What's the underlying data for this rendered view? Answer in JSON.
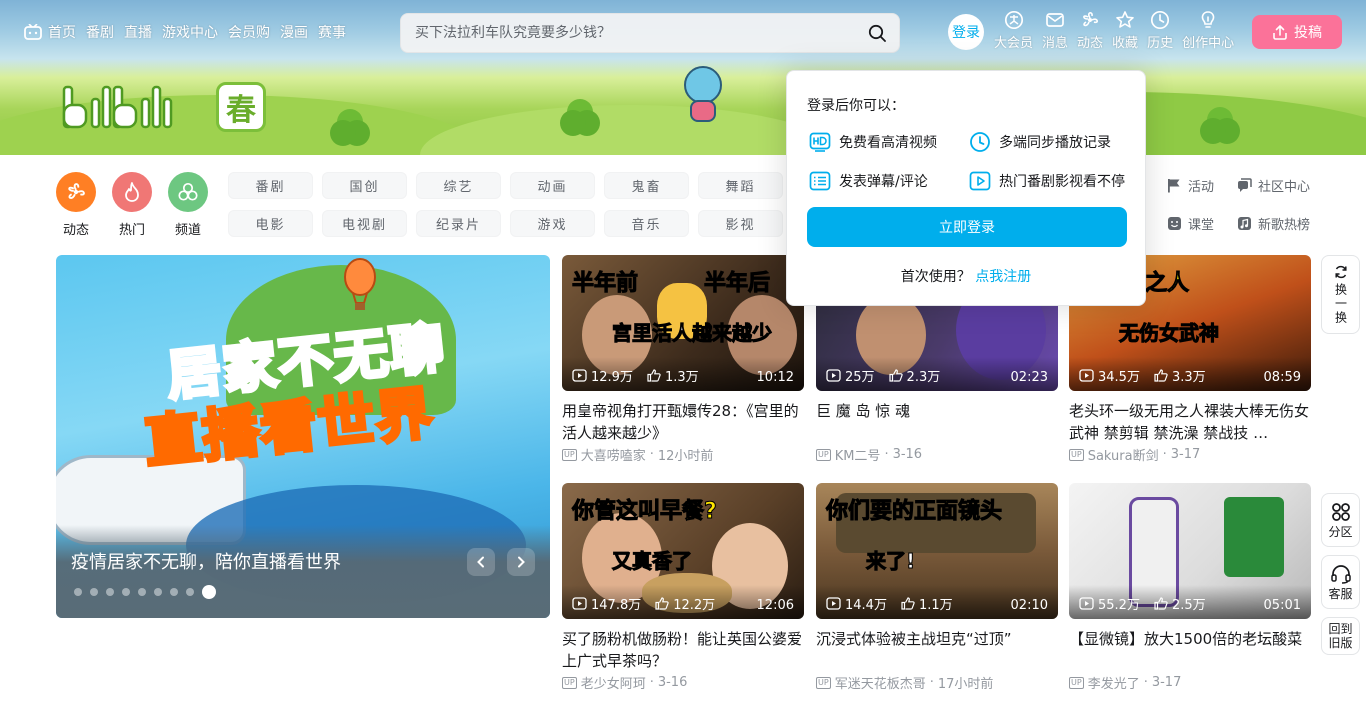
{
  "colors": {
    "brand_blue": "#00aeec",
    "brand_pink": "#fb7299",
    "dynamic_orange": "#ff7f24",
    "hot_red": "#f07775",
    "channel_green": "#6dc781"
  },
  "topnav": [
    {
      "label": "首页",
      "icon": "tv-icon"
    },
    {
      "label": "番剧"
    },
    {
      "label": "直播"
    },
    {
      "label": "游戏中心"
    },
    {
      "label": "会员购"
    },
    {
      "label": "漫画"
    },
    {
      "label": "赛事"
    }
  ],
  "search": {
    "placeholder": "买下法拉利车队究竟要多少钱？"
  },
  "header_right": {
    "login": "登录",
    "items": [
      {
        "label": "大会员",
        "icon": "vip-icon"
      },
      {
        "label": "消息",
        "icon": "mail-icon"
      },
      {
        "label": "动态",
        "icon": "wind-icon"
      },
      {
        "label": "收藏",
        "icon": "star-icon"
      },
      {
        "label": "历史",
        "icon": "clock-icon"
      },
      {
        "label": "创作中心",
        "icon": "bulb-icon"
      }
    ],
    "upload": "投稿"
  },
  "logo": {
    "seal": "春"
  },
  "channels": [
    {
      "label": "动态",
      "icon": "wind-icon",
      "color": "#ff7f24"
    },
    {
      "label": "热门",
      "icon": "flame-icon",
      "color": "#f07775"
    },
    {
      "label": "频道",
      "icon": "channel-icon",
      "color": "#6dc781"
    }
  ],
  "tags": [
    "番剧",
    "国创",
    "综艺",
    "动画",
    "鬼畜",
    "舞蹈",
    "电影",
    "电视剧",
    "纪录片",
    "游戏",
    "音乐",
    "影视"
  ],
  "side_links": [
    {
      "label": "活动",
      "icon": "flag-icon"
    },
    {
      "label": "社区中心",
      "icon": "community-icon"
    },
    {
      "label": "课堂",
      "icon": "class-icon"
    },
    {
      "label": "新歌热榜",
      "icon": "music-icon"
    }
  ],
  "banner": {
    "art_line1": "居家不无聊",
    "art_line2": "直播看世界",
    "caption": "疫情居家不无聊，陪你直播看世界",
    "dot_count": 9,
    "active_dot": 9
  },
  "videos": [
    {
      "views": "12.9万",
      "likes": "1.3万",
      "duration": "10:12",
      "title": "用皇帝视角打开甄嬛传28：《宫里的活人越来越少》",
      "author": "大喜唠嗑家",
      "time": "12小时前",
      "art1": "半年前　　　半年后",
      "art2": "宫里活人越来越少"
    },
    {
      "views": "25万",
      "likes": "2.3万",
      "duration": "02:23",
      "title": "巨 魔 岛 惊 魂",
      "author": "KM二号",
      "time": "3-16",
      "art1": "",
      "art2": ""
    },
    {
      "views": "34.5万",
      "likes": "3.3万",
      "duration": "08:59",
      "title": "老头环一级无用之人裸装大棒无伤女武神 禁剪辑 禁洗澡 禁战技 …",
      "author": "Sakura断剑",
      "time": "3-17",
      "art1": "级无用之人",
      "art2": "无伤女武神"
    },
    {
      "views": "147.8万",
      "likes": "12.2万",
      "duration": "12:06",
      "title": "买了肠粉机做肠粉！能让英国公婆爱上广式早茶吗？",
      "author": "老少女阿珂",
      "time": "3-16",
      "art1": "你管这叫早餐?",
      "art2": "又真香了"
    },
    {
      "views": "14.4万",
      "likes": "1.1万",
      "duration": "02:10",
      "title": "沉浸式体验被主战坦克“过顶”",
      "author": "军迷天花板杰哥",
      "time": "17小时前",
      "art1": "你们要的正面镜头",
      "art2": "来了!"
    },
    {
      "views": "55.2万",
      "likes": "2.5万",
      "duration": "05:01",
      "title": "【显微镜】放大1500倍的老坛酸菜",
      "author": "李发光了",
      "time": "3-17",
      "art1": "",
      "art2": ""
    }
  ],
  "float_buttons": [
    {
      "label": "换一换",
      "icon": "refresh-icon"
    },
    {
      "label": "分区",
      "icon": "grid-icon"
    },
    {
      "label": "客服",
      "icon": "headset-icon"
    },
    {
      "label": "回到旧版"
    }
  ],
  "login_popup": {
    "title": "登录后你可以：",
    "features": [
      {
        "label": "免费看高清视频",
        "icon": "hd-icon"
      },
      {
        "label": "多端同步播放记录",
        "icon": "clock-icon"
      },
      {
        "label": "发表弹幕/评论",
        "icon": "danmaku-icon"
      },
      {
        "label": "热门番剧影视看不停",
        "icon": "play-icon"
      }
    ],
    "button": "立即登录",
    "first_use": "首次使用？",
    "register": "点我注册"
  },
  "up_badge": "UP"
}
